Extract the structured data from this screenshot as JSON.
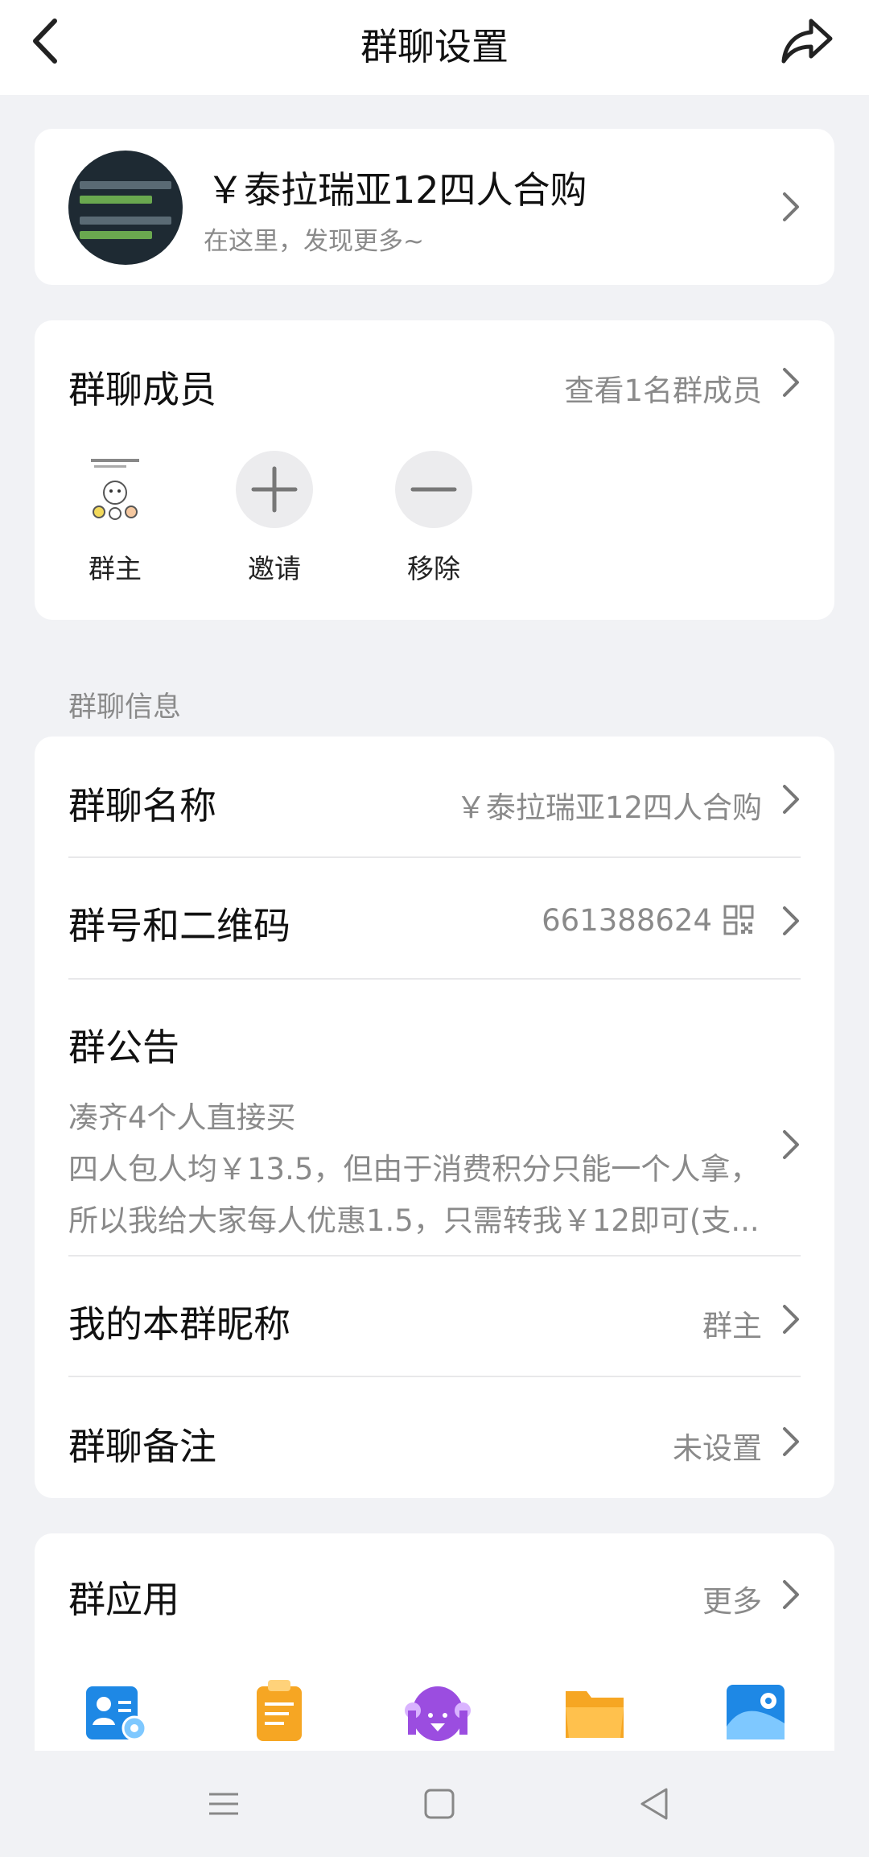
{
  "header": {
    "title": "群聊设置"
  },
  "group": {
    "name": "￥泰拉瑞亚12四人合购",
    "subtitle": "在这里，发现更多~"
  },
  "members": {
    "title": "群聊成员",
    "view_link": "查看1名群成员",
    "items": [
      {
        "label": "群主"
      },
      {
        "label": "邀请"
      },
      {
        "label": "移除"
      }
    ]
  },
  "info": {
    "section_label": "群聊信息",
    "name_row": {
      "title": "群聊名称",
      "value": "￥泰拉瑞亚12四人合购"
    },
    "number_row": {
      "title": "群号和二维码",
      "value": "661388624"
    },
    "notice_row": {
      "title": "群公告",
      "lines": [
        "凑齐4个人直接买",
        "四人包人均￥13.5，但由于消费积分只能一个人拿，",
        "所以我给大家每人优惠1.5，只需转我￥12即可(支..."
      ]
    },
    "nickname_row": {
      "title": "我的本群昵称",
      "value": "群主"
    },
    "remark_row": {
      "title": "群聊备注",
      "value": "未设置"
    }
  },
  "apps": {
    "title": "群应用",
    "more": "更多",
    "icons": [
      "member-settings-icon",
      "clipboard-icon",
      "purple-pet-icon",
      "folder-icon",
      "album-icon"
    ]
  },
  "nav": {
    "icons": [
      "menu-icon",
      "home-icon",
      "back-triangle-icon"
    ]
  },
  "colors": {
    "background": "#f1f2f5",
    "card": "#ffffff",
    "secondary_text": "#8a8a8a",
    "app_blue": "#1e88e5",
    "app_orange": "#f6a623",
    "app_purple": "#9b4de0"
  }
}
